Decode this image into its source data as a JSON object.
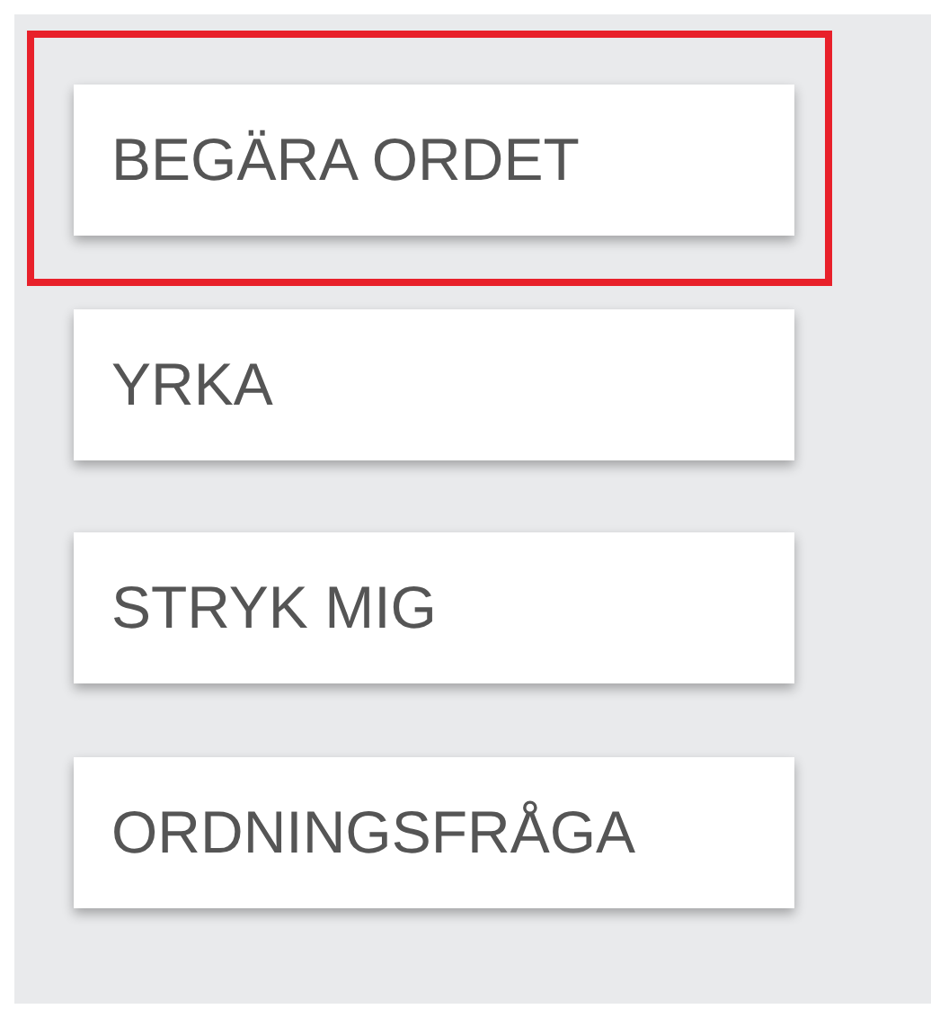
{
  "buttons": [
    {
      "label": "BEGÄRA ORDET",
      "highlighted": true
    },
    {
      "label": "YRKA",
      "highlighted": false
    },
    {
      "label": "STRYK MIG",
      "highlighted": false
    },
    {
      "label": "ORDNINGSFRÅGA",
      "highlighted": false
    }
  ]
}
